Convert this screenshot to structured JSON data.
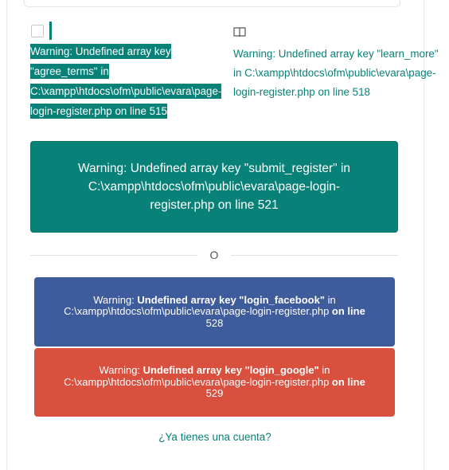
{
  "agree": {
    "warning": "Warning: Undefined array key \"agree_terms\" in C:\\xampp\\htdocs\\ofm\\public\\evara\\page-login-register.php on line 515"
  },
  "learn_more": {
    "icon": "book-open-icon",
    "warning": "Warning: Undefined array key \"learn_more\" in C:\\xampp\\htdocs\\ofm\\public\\evara\\page-login-register.php on line 518"
  },
  "submit": {
    "label": "Warning: Undefined array key \"submit_register\" in C:\\xampp\\htdocs\\ofm\\public\\evara\\page-login-register.php on line 521"
  },
  "divider": {
    "or_label": "O"
  },
  "facebook": {
    "prefix": "Warning: ",
    "key": "Undefined array key \"login_facebook\"",
    "mid": " in C:\\xampp\\htdocs\\ofm\\public\\evara\\page-login-register.php ",
    "on_line": "on line",
    "line": " 528"
  },
  "google": {
    "prefix": "Warning: ",
    "key": "Undefined array key \"login_google\"",
    "mid": " in C:\\xampp\\htdocs\\ofm\\public\\evara\\page-login-register.php ",
    "on_line": "on line",
    "line": " 529"
  },
  "account_link": "¿Ya tienes una cuenta?",
  "colors": {
    "brand": "#088178",
    "facebook": "#3e5b9b",
    "google": "#d9503f"
  }
}
